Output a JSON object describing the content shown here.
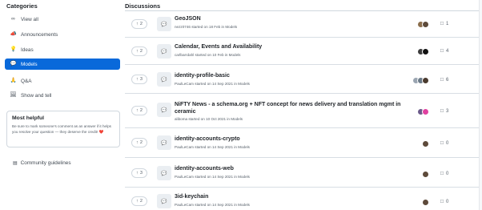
{
  "sidebar": {
    "title": "Categories",
    "items": [
      {
        "label": "View all",
        "icon": "infinity-icon",
        "glyph": "∞"
      },
      {
        "label": "Announcements",
        "icon": "megaphone-icon",
        "glyph": "📣"
      },
      {
        "label": "Ideas",
        "icon": "lightbulb-icon",
        "glyph": "💡"
      },
      {
        "label": "Models",
        "icon": "speech-bubble-icon",
        "glyph": "💬"
      },
      {
        "label": "Q&A",
        "icon": "pray-icon",
        "glyph": "🙏"
      },
      {
        "label": "Show and tell",
        "icon": "framed-picture-icon",
        "glyph": "🖼"
      }
    ],
    "helpful": {
      "title": "Most helpful",
      "text": "Be sure to mark someone's comment as an answer if it helps you resolve your question — they deserve the credit! ❤️"
    },
    "guidelines": "Community guidelines"
  },
  "main": {
    "title": "Discussions",
    "rows": [
      {
        "votes": "2",
        "title": "GeoJSON",
        "meta": "nezz0746 started on 18 Feb in Models",
        "comments": "1"
      },
      {
        "votes": "2",
        "title": "Calendar, Events and Availability",
        "meta": "carlbarrdahl started on 10 Feb in Models",
        "comments": "4"
      },
      {
        "votes": "3",
        "title": "identity-profile-basic",
        "meta": "PaulLeCam started on 14 Sep 2021 in Models",
        "comments": "6"
      },
      {
        "votes": "2",
        "title": "NiFTY News - a schema.org + NFT concept for news delivery and translation mgmt in ceramic",
        "meta": "aliboma started on 10 Oct 2021 in Models",
        "comments": "3"
      },
      {
        "votes": "2",
        "title": "identity-accounts-crypto",
        "meta": "PaulLeCam started on 14 Sep 2021 in Models",
        "comments": "0"
      },
      {
        "votes": "3",
        "title": "identity-accounts-web",
        "meta": "PaulLeCam started on 14 Sep 2021 in Models",
        "comments": "0"
      },
      {
        "votes": "2",
        "title": "3id-keychain",
        "meta": "PaulLeCam started on 14 Sep 2021 in Models",
        "comments": "0"
      }
    ]
  },
  "colors": {
    "accent": "#0969da",
    "border": "#d0d7de",
    "muted": "#57606a"
  }
}
